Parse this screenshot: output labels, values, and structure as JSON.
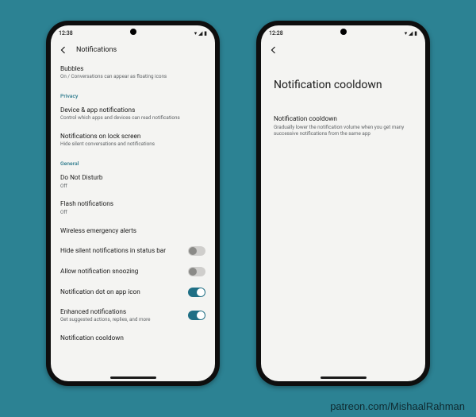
{
  "credit": "patreon.com/MishaalRahman",
  "accent": "#1f6f85",
  "phone1": {
    "status": {
      "time": "12:38",
      "icons": "▾ ◢ ▮"
    },
    "appbar": {
      "title": "Notifications"
    },
    "rows": {
      "bubbles": {
        "title": "Bubbles",
        "sub": "On / Conversations can appear as floating icons"
      },
      "privacy_head": "Privacy",
      "device_app": {
        "title": "Device & app notifications",
        "sub": "Control which apps and devices can read notifications"
      },
      "lock": {
        "title": "Notifications on lock screen",
        "sub": "Hide silent conversations and notifications"
      },
      "general_head": "General",
      "dnd": {
        "title": "Do Not Disturb",
        "sub": "Off"
      },
      "flash": {
        "title": "Flash notifications",
        "sub": "Off"
      },
      "wea": {
        "title": "Wireless emergency alerts"
      },
      "hide_silent": {
        "title": "Hide silent notifications in status bar",
        "on": false
      },
      "snooze": {
        "title": "Allow notification snoozing",
        "on": false
      },
      "dot": {
        "title": "Notification dot on app icon",
        "on": true
      },
      "enhanced": {
        "title": "Enhanced notifications",
        "sub": "Get suggested actions, replies, and more",
        "on": true
      },
      "cooldown": {
        "title": "Notification cooldown"
      }
    }
  },
  "phone2": {
    "status": {
      "time": "12:28",
      "icons": "▾ ◢ ▮"
    },
    "big_title": "Notification cooldown",
    "detail": {
      "title": "Notification cooldown",
      "sub": "Gradually lower the notification volume when you get many successive notifications from the same app"
    }
  }
}
